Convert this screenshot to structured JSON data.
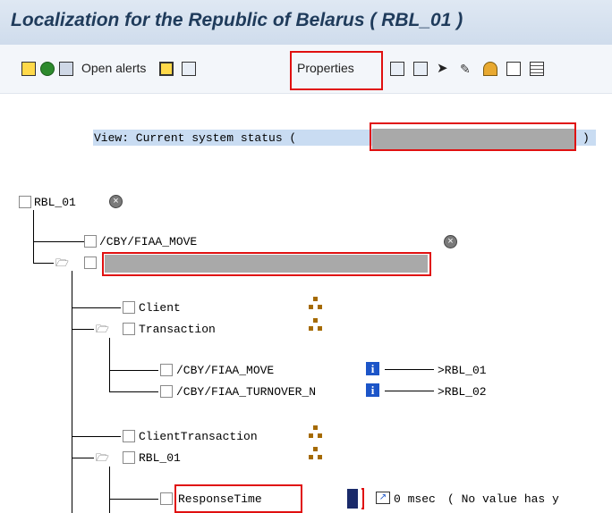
{
  "window": {
    "title": "Localization for the Republic of Belarus ( RBL_01 )"
  },
  "toolbar": {
    "open_alerts_label": "Open alerts",
    "properties_label": "Properties",
    "icons": [
      "choose-icon",
      "refresh-icon",
      "expand-icon",
      "open-alerts-icon",
      "save-icon",
      "display-icon",
      "tree-icon",
      "tree-icon-2",
      "pointer-icon",
      "tool-icon",
      "person-icon",
      "notes-icon",
      "grid-icon"
    ]
  },
  "view": {
    "prefix": "View: Current system status (",
    "suffix": ")",
    "status_value": ""
  },
  "tree": {
    "root_label": "RBL_01",
    "move_label": "/CBY/FIAA_MOVE",
    "client_label": "Client",
    "transaction_label": "Transaction",
    "tx1_label": "/CBY/FIAA_MOVE",
    "tx1_target": ">RBL_01",
    "tx2_label": "/CBY/FIAA_TURNOVER_N",
    "tx2_target": ">RBL_02",
    "client_transaction_label": "ClientTransaction",
    "sub_rbl_label": "RBL_01",
    "response_time_label": "ResponseTime",
    "response_value": "0 msec",
    "response_note": "( No value has y"
  },
  "colors": {
    "highlight": "#e01010",
    "view_bg": "#c9dcf2",
    "redacted": "#a9a9a9"
  }
}
